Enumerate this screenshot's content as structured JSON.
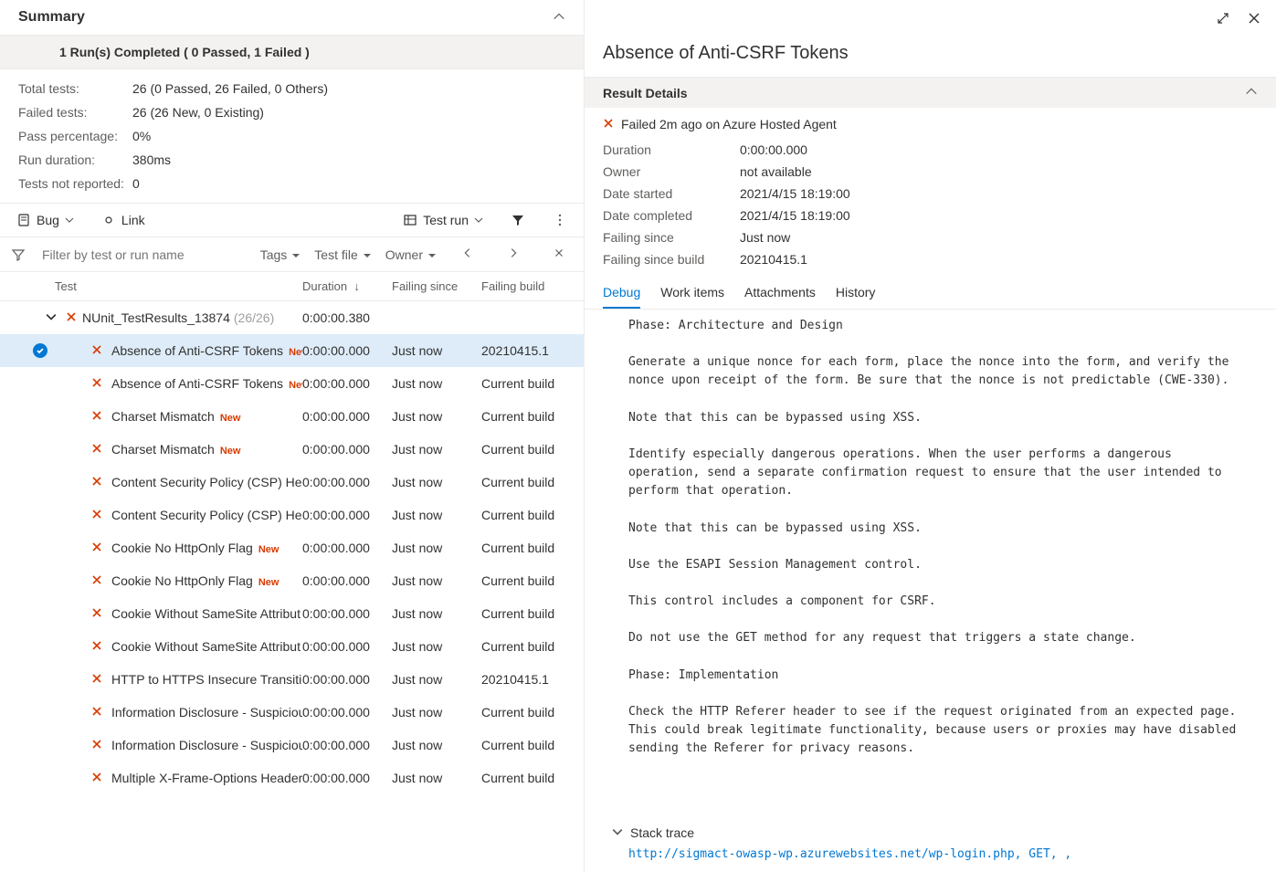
{
  "summary": {
    "title": "Summary",
    "run_status": "1 Run(s) Completed ( 0 Passed, 1 Failed )",
    "rows": [
      {
        "k": "Total tests:",
        "v": "26 (0 Passed, 26 Failed, 0 Others)"
      },
      {
        "k": "Failed tests:",
        "v": "26 (26 New, 0 Existing)"
      },
      {
        "k": "Pass percentage:",
        "v": "0%"
      },
      {
        "k": "Run duration:",
        "v": "380ms"
      },
      {
        "k": "Tests not reported:",
        "v": "0"
      }
    ]
  },
  "toolbar": {
    "bug": "Bug",
    "link": "Link",
    "test_run": "Test run"
  },
  "filter": {
    "placeholder": "Filter by test or run name",
    "tags": "Tags",
    "test_file": "Test file",
    "owner": "Owner"
  },
  "columns": {
    "test": "Test",
    "duration": "Duration",
    "failing_since": "Failing since",
    "failing_build": "Failing build"
  },
  "group": {
    "name": "NUnit_TestResults_13874",
    "count": "(26/26)",
    "duration": "0:00:00.380"
  },
  "tests": [
    {
      "name": "Absence of Anti-CSRF Tokens",
      "new": true,
      "dur": "0:00:00.000",
      "fs": "Just now",
      "fb": "20210415.1",
      "selected": true
    },
    {
      "name": "Absence of Anti-CSRF Tokens",
      "new": true,
      "dur": "0:00:00.000",
      "fs": "Just now",
      "fb": "Current build"
    },
    {
      "name": "Charset Mismatch",
      "new": true,
      "dur": "0:00:00.000",
      "fs": "Just now",
      "fb": "Current build"
    },
    {
      "name": "Charset Mismatch",
      "new": true,
      "dur": "0:00:00.000",
      "fs": "Just now",
      "fb": "Current build"
    },
    {
      "name": "Content Security Policy (CSP) Heac",
      "new": false,
      "dur": "0:00:00.000",
      "fs": "Just now",
      "fb": "Current build"
    },
    {
      "name": "Content Security Policy (CSP) Heac",
      "new": false,
      "dur": "0:00:00.000",
      "fs": "Just now",
      "fb": "Current build"
    },
    {
      "name": "Cookie No HttpOnly Flag",
      "new": true,
      "dur": "0:00:00.000",
      "fs": "Just now",
      "fb": "Current build"
    },
    {
      "name": "Cookie No HttpOnly Flag",
      "new": true,
      "dur": "0:00:00.000",
      "fs": "Just now",
      "fb": "Current build"
    },
    {
      "name": "Cookie Without SameSite Attribut",
      "new": false,
      "dur": "0:00:00.000",
      "fs": "Just now",
      "fb": "Current build"
    },
    {
      "name": "Cookie Without SameSite Attribut",
      "new": false,
      "dur": "0:00:00.000",
      "fs": "Just now",
      "fb": "Current build"
    },
    {
      "name": "HTTP to HTTPS Insecure Transitior",
      "new": false,
      "dur": "0:00:00.000",
      "fs": "Just now",
      "fb": "20210415.1"
    },
    {
      "name": "Information Disclosure - Suspiciou",
      "new": false,
      "dur": "0:00:00.000",
      "fs": "Just now",
      "fb": "Current build"
    },
    {
      "name": "Information Disclosure - Suspiciou",
      "new": false,
      "dur": "0:00:00.000",
      "fs": "Just now",
      "fb": "Current build"
    },
    {
      "name": "Multiple X-Frame-Options Header",
      "new": false,
      "dur": "0:00:00.000",
      "fs": "Just now",
      "fb": "Current build"
    }
  ],
  "detail": {
    "title": "Absence of Anti-CSRF Tokens",
    "section": "Result Details",
    "fail_line": "Failed 2m ago on Azure Hosted Agent",
    "props": [
      {
        "k": "Duration",
        "v": "0:00:00.000"
      },
      {
        "k": "Owner",
        "v": "not available"
      },
      {
        "k": "Date started",
        "v": "2021/4/15 18:19:00"
      },
      {
        "k": "Date completed",
        "v": "2021/4/15 18:19:00"
      },
      {
        "k": "Failing since",
        "v": "Just now"
      },
      {
        "k": "Failing since build",
        "v": "20210415.1"
      }
    ],
    "tabs": {
      "debug": "Debug",
      "work_items": "Work items",
      "attachments": "Attachments",
      "history": "History"
    },
    "debug_text": "Phase: Architecture and Design\n\nGenerate a unique nonce for each form, place the nonce into the form, and verify the nonce upon receipt of the form. Be sure that the nonce is not predictable (CWE-330).\n\nNote that this can be bypassed using XSS.\n\nIdentify especially dangerous operations. When the user performs a dangerous operation, send a separate confirmation request to ensure that the user intended to perform that operation.\n\nNote that this can be bypassed using XSS.\n\nUse the ESAPI Session Management control.\n\nThis control includes a component for CSRF.\n\nDo not use the GET method for any request that triggers a state change.\n\nPhase: Implementation\n\nCheck the HTTP Referer header to see if the request originated from an expected page. This could break legitimate functionality, because users or proxies may have disabled sending the Referer for privacy reasons.",
    "stack_title": "Stack trace",
    "stack_link": "http://sigmact-owasp-wp.azurewebsites.net/wp-login.php, GET, ,"
  }
}
